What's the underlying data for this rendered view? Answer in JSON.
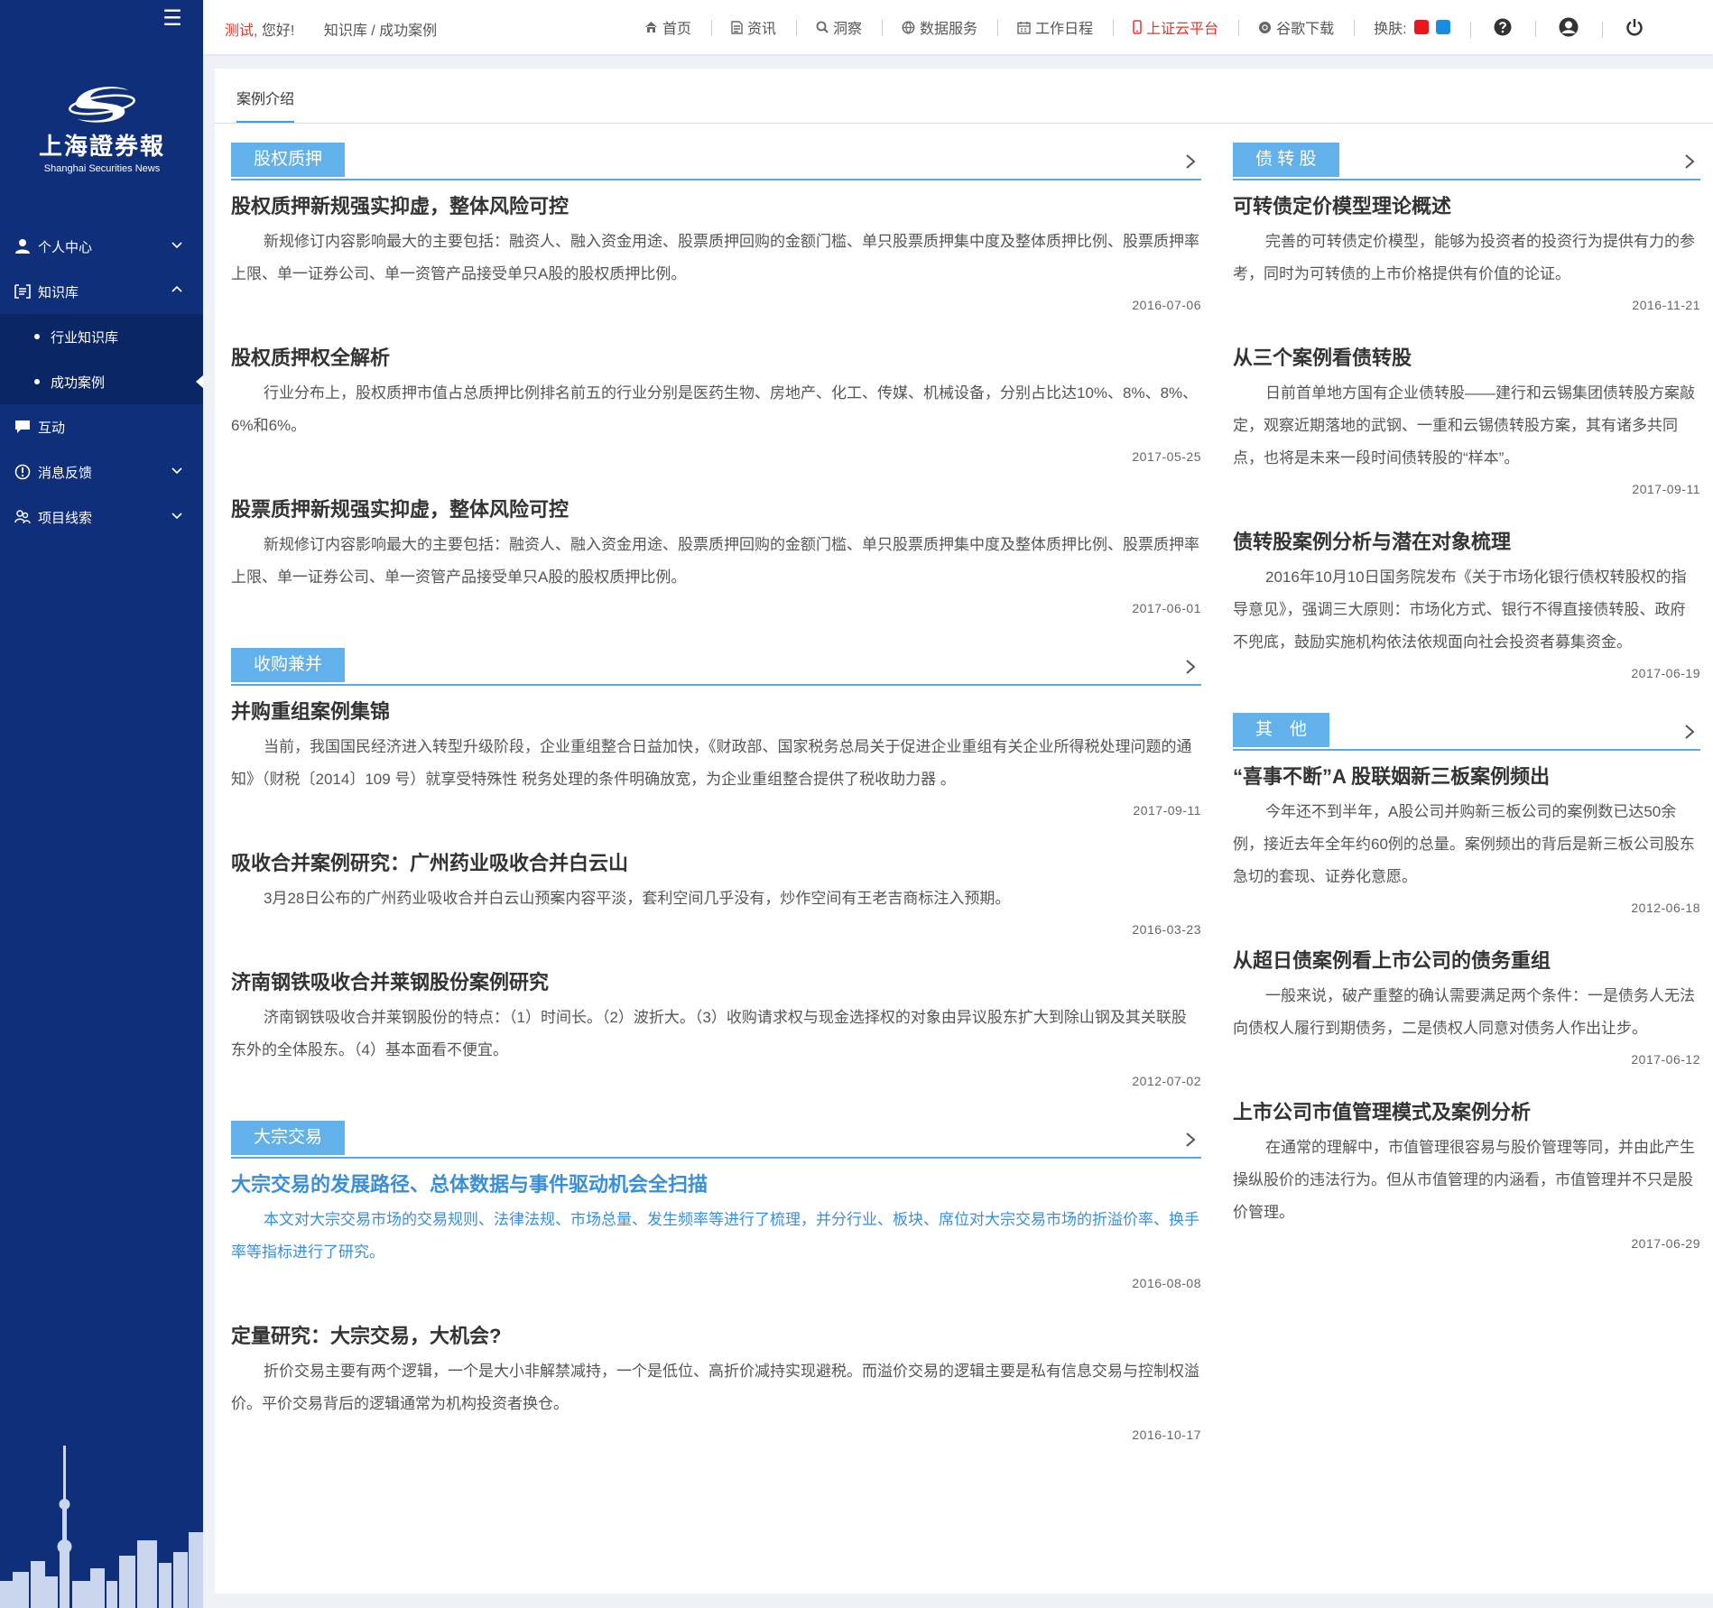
{
  "sidebar": {
    "logo_cn": "上海證券報",
    "logo_en": "Shanghai Securities News",
    "items": [
      {
        "label": "个人中心"
      },
      {
        "label": "知识库"
      },
      {
        "label": "行业知识库"
      },
      {
        "label": "成功案例"
      },
      {
        "label": "互动"
      },
      {
        "label": "消息反馈"
      },
      {
        "label": "项目线索"
      }
    ]
  },
  "header": {
    "user": "测试,",
    "greeting": "您好!",
    "breadcrumb": "知识库 / 成功案例",
    "nav": [
      {
        "label": "首页",
        "icon": "home-icon"
      },
      {
        "label": "资讯",
        "icon": "document-icon"
      },
      {
        "label": "洞察",
        "icon": "search-icon"
      },
      {
        "label": "数据服务",
        "icon": "globe-icon"
      },
      {
        "label": "工作日程",
        "icon": "calendar-icon"
      },
      {
        "label": "上证云平台",
        "icon": "mobile-icon"
      },
      {
        "label": "谷歌下载",
        "icon": "chrome-icon"
      }
    ],
    "skin_label": "换肤:",
    "skin_colors": [
      "#e8191c",
      "#1a8ce0"
    ],
    "accent_red": "#e4362c"
  },
  "main": {
    "tab": "案例介绍",
    "left_sections": [
      {
        "tag": "股权质押",
        "articles": [
          {
            "title": "股权质押新规强实抑虚，整体风险可控",
            "summary": "新规修订内容影响最大的主要包括：融资人、融入资金用途、股票质押回购的金额门槛、单只股票质押集中度及整体质押比例、股票质押率上限、单一证券公司、单一资管产品接受单只A股的股权质押比例。",
            "date": "2016-07-06"
          },
          {
            "title": "股权质押权全解析",
            "summary": "行业分布上，股权质押市值占总质押比例排名前五的行业分别是医药生物、房地产、化工、传媒、机械设备，分别占比达10%、8%、8%、6%和6%。",
            "date": "2017-05-25"
          },
          {
            "title": "股票质押新规强实抑虚，整体风险可控",
            "summary": "新规修订内容影响最大的主要包括：融资人、融入资金用途、股票质押回购的金额门槛、单只股票质押集中度及整体质押比例、股票质押率上限、单一证券公司、单一资管产品接受单只A股的股权质押比例。",
            "date": "2017-06-01"
          }
        ]
      },
      {
        "tag": "收购兼并",
        "articles": [
          {
            "title": "并购重组案例集锦",
            "summary": "当前，我国国民经济进入转型升级阶段，企业重组整合日益加快，《财政部、国家税务总局关于促进企业重组有关企业所得税处理问题的通知》（财税〔2014〕109 号）就享受特殊性 税务处理的条件明确放宽，为企业重组整合提供了税收助力器 。",
            "date": "2017-09-11"
          },
          {
            "title": "吸收合并案例研究：广州药业吸收合并白云山",
            "summary": "3月28日公布的广州药业吸收合并白云山预案内容平淡，套利空间几乎没有，炒作空间有王老吉商标注入预期。",
            "date": "2016-03-23"
          },
          {
            "title": "济南钢铁吸收合并莱钢股份案例研究",
            "summary": "济南钢铁吸收合并莱钢股份的特点：（1）时间长。（2）波折大。（3）收购请求权与现金选择权的对象由异议股东扩大到除山钢及其关联股东外的全体股东。（4）基本面看不便宜。",
            "date": "2012-07-02"
          }
        ]
      },
      {
        "tag": "大宗交易",
        "articles": [
          {
            "title": "大宗交易的发展路径、总体数据与事件驱动机会全扫描",
            "summary": "本文对大宗交易市场的交易规则、法律法规、市场总量、发生频率等进行了梳理，并分行业、板块、席位对大宗交易市场的折溢价率、换手率等指标进行了研究。",
            "date": "2016-08-08",
            "highlight": true
          },
          {
            "title": "定量研究：大宗交易，大机会?",
            "summary": "折价交易主要有两个逻辑，一个是大小非解禁减持，一个是低位、高折价减持实现避税。而溢价交易的逻辑主要是私有信息交易与控制权溢价。平价交易背后的逻辑通常为机构投资者换仓。",
            "date": "2016-10-17"
          }
        ]
      }
    ],
    "right_sections": [
      {
        "tag": "债 转 股",
        "articles": [
          {
            "title": "可转债定价模型理论概述",
            "summary": "完善的可转债定价模型，能够为投资者的投资行为提供有力的参考，同时为可转债的上市价格提供有价值的论证。",
            "date": "2016-11-21"
          },
          {
            "title": "从三个案例看债转股",
            "summary": "日前首单地方国有企业债转股——建行和云锡集团债转股方案敲定，观察近期落地的武钢、一重和云锡债转股方案，其有诸多共同点，也将是未来一段时间债转股的“样本”。",
            "date": "2017-09-11"
          },
          {
            "title": "债转股案例分析与潜在对象梳理",
            "summary": "2016年10月10日国务院发布《关于市场化银行债权转股权的指导意见》，强调三大原则：市场化方式、银行不得直接债转股、政府不兜底，鼓励实施机构依法依规面向社会投资者募集资金。",
            "date": "2017-06-19"
          }
        ]
      },
      {
        "tag": "其　他",
        "articles": [
          {
            "title": "“喜事不断”A 股联姻新三板案例频出",
            "summary": "今年还不到半年，A股公司并购新三板公司的案例数已达50余例，接近去年全年约60例的总量。案例频出的背后是新三板公司股东急切的套现、证券化意愿。",
            "date": "2012-06-18"
          },
          {
            "title": "从超日债案例看上市公司的债务重组",
            "summary": "一般来说，破产重整的确认需要满足两个条件：一是债务人无法向债权人履行到期债务，二是债权人同意对债务人作出让步。",
            "date": "2017-06-12"
          },
          {
            "title": "上市公司市值管理模式及案例分析",
            "summary": "在通常的理解中，市值管理很容易与股价管理等同，并由此产生操纵股价的违法行为。但从市值管理的内涵看，市值管理并不只是股价管理。",
            "date": "2017-06-29"
          }
        ]
      }
    ]
  }
}
